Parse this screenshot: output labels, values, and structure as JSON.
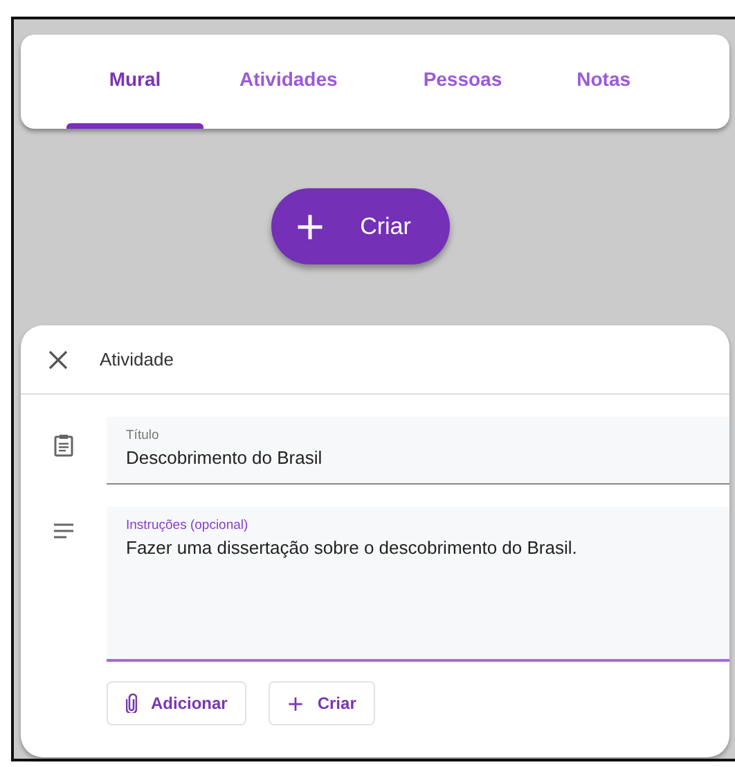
{
  "tabs": [
    {
      "label": "Mural",
      "selected": true
    },
    {
      "label": "Atividades",
      "selected": false
    },
    {
      "label": "Pessoas",
      "selected": false
    },
    {
      "label": "Notas",
      "selected": false
    }
  ],
  "create_button": {
    "label": "Criar"
  },
  "dialog": {
    "title": "Atividade",
    "fields": [
      {
        "kind": "title",
        "label": "Título",
        "value": "Descobrimento do Brasil",
        "focused": false
      },
      {
        "kind": "instructions",
        "label": "Instruções (opcional)",
        "value": "Fazer uma dissertação sobre o descobrimento do Brasil.",
        "focused": true
      }
    ],
    "buttons": [
      {
        "kind": "attach",
        "label": "Adicionar"
      },
      {
        "kind": "create",
        "label": "Criar"
      }
    ]
  }
}
